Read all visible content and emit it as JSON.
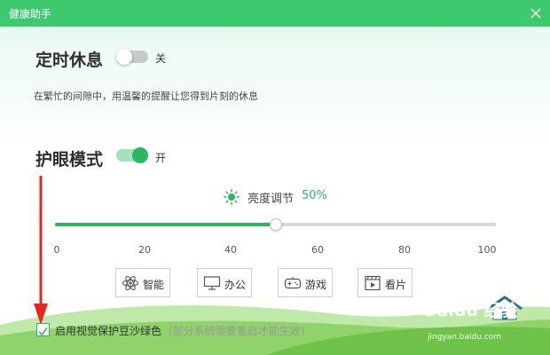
{
  "window": {
    "title": "健康助手"
  },
  "rest": {
    "title": "定时休息",
    "toggle_state": "关",
    "enabled": false,
    "description": "在繁忙的间隙中，用温馨的提醒让您得到片刻的休息"
  },
  "eye_care": {
    "title": "护眼模式",
    "toggle_state": "开",
    "enabled": true,
    "brightness_label": "亮度调节",
    "brightness_value": "50%",
    "brightness_level": 50,
    "ticks": [
      "0",
      "20",
      "40",
      "60",
      "80",
      "100"
    ],
    "modes": [
      {
        "label": "智能",
        "icon": "atom-icon"
      },
      {
        "label": "办公",
        "icon": "monitor-icon"
      },
      {
        "label": "游戏",
        "icon": "gamepad-icon"
      },
      {
        "label": "看片",
        "icon": "film-icon"
      }
    ]
  },
  "sandbeige": {
    "checked": true,
    "label": "启用视觉保护豆沙绿色",
    "note": "(部分系统需要重启才能生效)"
  },
  "watermark": {
    "logo": "Baidu 经验",
    "url": "jingyan.baidu.com"
  },
  "colors": {
    "accent": "#2bb760",
    "titlebar": "#3ec96f",
    "arrow": "#e8261b"
  }
}
